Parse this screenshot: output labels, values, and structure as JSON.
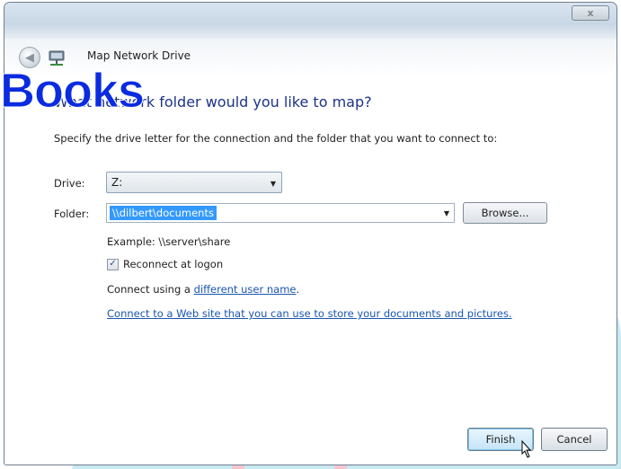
{
  "window": {
    "title": "Map Network Drive",
    "close_label": "x"
  },
  "watermark": {
    "text": "Books"
  },
  "heading": "What network folder would you like to map?",
  "intro": "Specify the drive letter for the connection and the folder that you want to connect to:",
  "drive": {
    "label": "Drive:",
    "value": "Z:"
  },
  "folder": {
    "label": "Folder:",
    "value": "\\\\dilbert\\documents"
  },
  "browse_label": "Browse...",
  "example": "Example: \\\\server\\share",
  "reconnect": {
    "label": "Reconnect at logon",
    "checked": true
  },
  "connect_using": {
    "prefix": "Connect using a ",
    "link": "different user name",
    "suffix": "."
  },
  "web_link": "Connect to a Web site that you can use to store your documents and pictures.",
  "buttons": {
    "finish": "Finish",
    "cancel": "Cancel"
  },
  "colors": {
    "heading": "#1e3287",
    "link": "#1a56b0",
    "selection": "#3399ff",
    "watermark": "#0b2be0"
  },
  "icons": [
    "back-arrow-icon",
    "network-drive-icon",
    "dropdown-arrow-icon",
    "checkmark-icon",
    "mouse-cursor-icon"
  ]
}
